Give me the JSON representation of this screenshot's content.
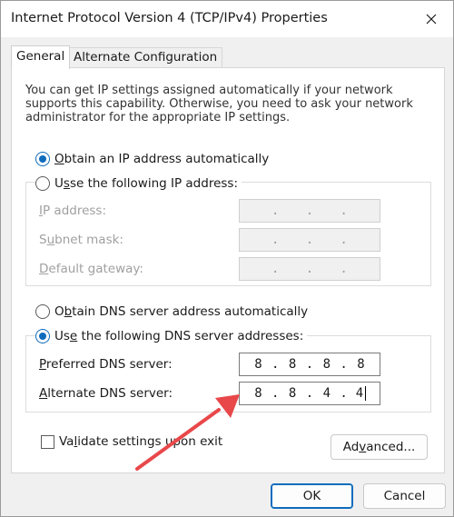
{
  "window": {
    "title": "Internet Protocol Version 4 (TCP/IPv4) Properties"
  },
  "tabs": [
    {
      "label": "General",
      "active": true
    },
    {
      "label": "Alternate Configuration",
      "active": false
    }
  ],
  "intro_text": "You can get IP settings assigned automatically if your network supports this capability. Otherwise, you need to ask your network administrator for the appropriate IP settings.",
  "ip_mode": {
    "auto_label_mnemonic": "O",
    "auto_label_rest": "btain an IP address automatically",
    "manual_label_pre": "U",
    "manual_label_rest": "se the following IP address:",
    "auto_selected": true
  },
  "ip_fields": [
    {
      "label_mnemonic": "I",
      "label_rest": "P address:",
      "octets": [
        "",
        "",
        "",
        ""
      ]
    },
    {
      "label_mnemonic": "u",
      "label_pre": "S",
      "label_rest": "bnet mask:",
      "octets": [
        "",
        "",
        "",
        ""
      ]
    },
    {
      "label_mnemonic": "D",
      "label_rest": "efault gateway:",
      "octets": [
        "",
        "",
        "",
        ""
      ]
    }
  ],
  "dns_mode": {
    "auto_label_pre": "O",
    "auto_label_mnemonic": "b",
    "auto_label_rest": "tain DNS server address automatically",
    "manual_label_pre": "Us",
    "manual_label_mnemonic": "e",
    "manual_label_rest": " the following DNS server addresses:",
    "manual_selected": true
  },
  "dns_fields": {
    "preferred": {
      "label_mnemonic": "P",
      "label_rest": "referred DNS server:",
      "octets": [
        "8",
        "8",
        "8",
        "8"
      ]
    },
    "alternate": {
      "label_mnemonic": "A",
      "label_rest": "lternate DNS server:",
      "octets": [
        "8",
        "8",
        "4",
        "4"
      ]
    }
  },
  "validate": {
    "label_pre": "Va",
    "label_mnemonic": "l",
    "label_rest": "idate settings upon exit",
    "checked": false
  },
  "buttons": {
    "advanced_pre": "Ad",
    "advanced_mnemonic": "v",
    "advanced_rest": "anced...",
    "ok": "OK",
    "cancel": "Cancel"
  },
  "colors": {
    "accent": "#0f6cbd",
    "annotation_arrow": "#e8484a"
  }
}
